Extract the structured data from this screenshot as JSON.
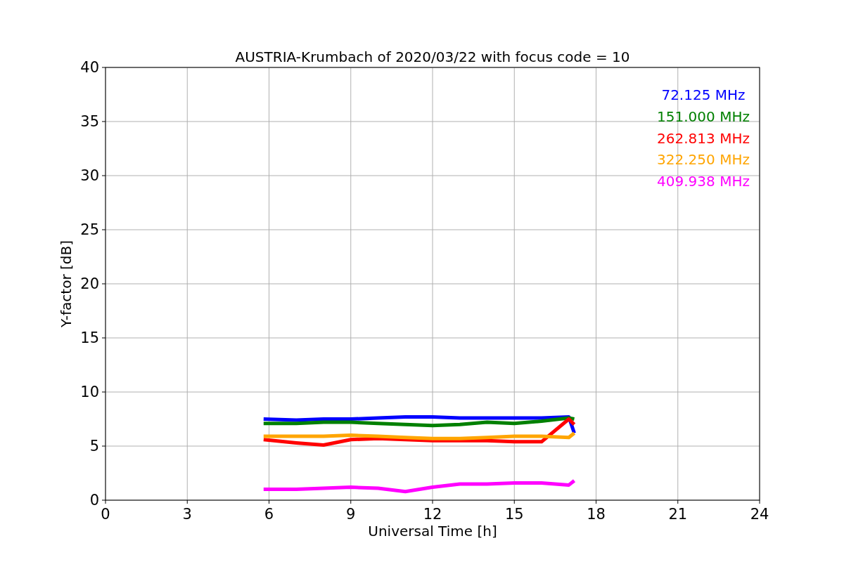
{
  "chart": {
    "chart_data": {
      "type": "line",
      "title": "AUSTRIA-Krumbach of 2020/03/22 with focus code = 10",
      "xlabel": "Universal Time [h]",
      "ylabel": "Y-factor [dB]",
      "x": [
        5.8,
        7,
        8,
        9,
        10,
        11,
        12,
        13,
        14,
        15,
        16,
        17,
        17.2
      ],
      "series": [
        {
          "name": "72.125 MHz",
          "color": "#0000ff",
          "values": [
            7.5,
            7.4,
            7.5,
            7.5,
            7.6,
            7.7,
            7.7,
            7.6,
            7.6,
            7.6,
            7.6,
            7.7,
            6.2
          ]
        },
        {
          "name": "151.000 MHz",
          "color": "#008000",
          "values": [
            7.1,
            7.1,
            7.2,
            7.2,
            7.1,
            7.0,
            6.9,
            7.0,
            7.2,
            7.1,
            7.3,
            7.6,
            7.5
          ]
        },
        {
          "name": "262.813 MHz",
          "color": "#ff0000",
          "values": [
            5.6,
            5.3,
            5.1,
            5.6,
            5.7,
            5.6,
            5.5,
            5.5,
            5.5,
            5.4,
            5.4,
            7.5,
            7.0
          ]
        },
        {
          "name": "322.250 MHz",
          "color": "#ffa500",
          "values": [
            5.9,
            5.9,
            5.9,
            6.0,
            5.9,
            5.8,
            5.7,
            5.7,
            5.8,
            5.9,
            5.9,
            5.8,
            6.2
          ]
        },
        {
          "name": "409.938 MHz",
          "color": "#ff00ff",
          "values": [
            1.0,
            1.0,
            1.1,
            1.2,
            1.1,
            0.8,
            1.2,
            1.5,
            1.5,
            1.6,
            1.6,
            1.4,
            1.8
          ]
        }
      ],
      "grid": true,
      "xlim": [
        0,
        24
      ],
      "ylim": [
        0,
        40
      ],
      "xticks": [
        0,
        3,
        6,
        9,
        12,
        15,
        18,
        21,
        24
      ],
      "yticks": [
        0,
        5,
        10,
        15,
        20,
        25,
        30,
        35,
        40
      ]
    }
  }
}
